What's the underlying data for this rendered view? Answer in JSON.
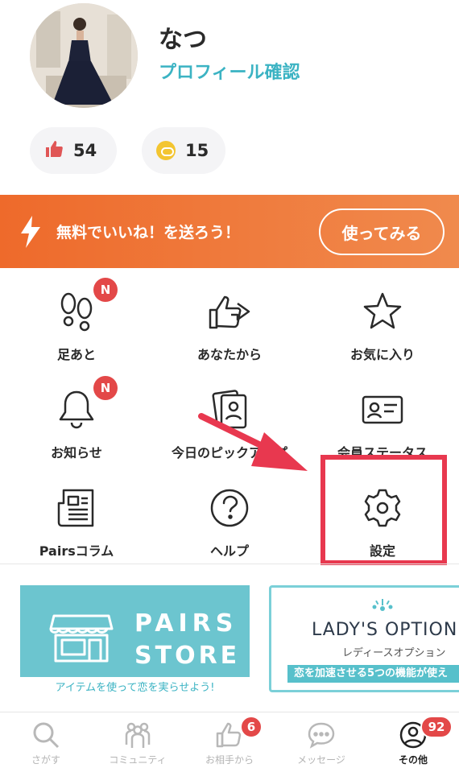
{
  "profile": {
    "name": "なつ",
    "link_label": "プロフィール確認",
    "likes_count": "54",
    "coins_count": "15"
  },
  "banner": {
    "text": "無料でいいね！を送ろう！",
    "button_label": "使ってみる"
  },
  "menu": {
    "footprints": "足あと",
    "from_you": "あなたから",
    "favorites": "お気に入り",
    "notifications": "お知らせ",
    "todays_pickup": "今日のピックアップ",
    "member_status": "会員ステータス",
    "pairs_column": "Pairsコラム",
    "help": "ヘルプ",
    "settings": "設定",
    "new_badge": "N"
  },
  "promos": {
    "store_word1": "PAIRS",
    "store_word2": "STORE",
    "store_caption": "アイテムを使って恋を実らせよう!",
    "lady_title": "LADY'S OPTION",
    "lady_sub": "レディースオプション",
    "lady_strip": "恋を加速させる5つの機能が使え"
  },
  "tabs": {
    "search": "さがす",
    "community": "コミュニティ",
    "from_partner": "お相手から",
    "from_partner_badge": "6",
    "messages": "メッセージ",
    "other": "その他",
    "other_badge": "92"
  },
  "colors": {
    "accent_teal": "#3bb3c3",
    "banner_orange": "#ee6a2b",
    "badge_red": "#e34848",
    "highlight_red": "#e8384f"
  }
}
